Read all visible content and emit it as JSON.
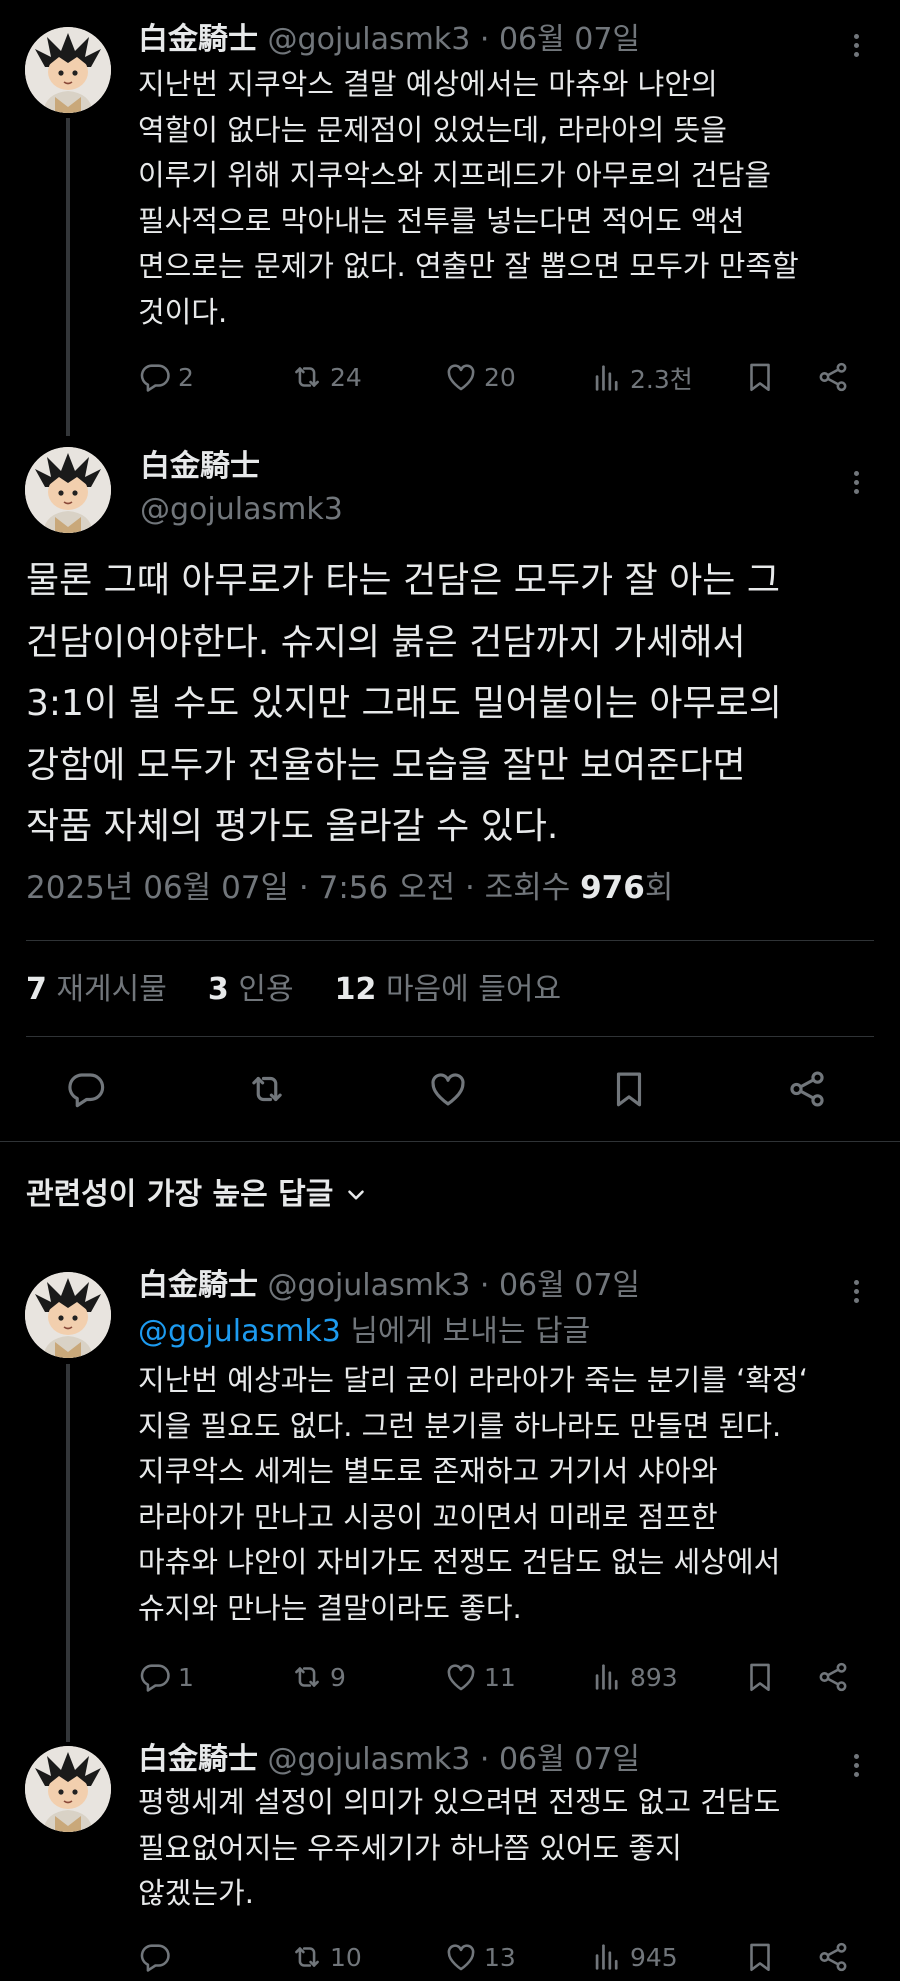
{
  "posts": [
    {
      "name": "白金騎士",
      "handle": "@gojulasmk3",
      "date": "· 06월 07일",
      "text": "지난번 지쿠악스 결말 예상에서는 마츄와 냐안의\n역할이 없다는 문제점이 있었는데, 라라아의 뜻을\n이루기 위해 지쿠악스와 지프레드가 아무로의 건담을\n필사적으로 막아내는 전투를 넣는다면 적어도 액션\n면으로는 문제가 없다. 연출만 잘 뽑으면 모두가 만족할\n것이다.",
      "replies": "2",
      "reposts": "24",
      "likes": "20",
      "views": "2.3천"
    }
  ],
  "main_post": {
    "name": "白金騎士",
    "handle": "@gojulasmk3",
    "text": "물론 그때 아무로가 타는 건담은 모두가 잘 아는 그\n건담이어야한다. 슈지의 붉은 건담까지 가세해서\n3:1이 될 수도 있지만 그래도 밀어붙이는 아무로의\n강함에 모두가 전율하는 모습을 잘만 보여준다면\n작품 자체의 평가도 올라갈 수 있다.",
    "timestamp": "2025년 06월 07일 · 7:56 오전 · 조회수 ",
    "views_count": "976",
    "views_suffix": "회",
    "stats": {
      "reposts_count": "7",
      "reposts_label": "재게시물",
      "quotes_count": "3",
      "quotes_label": "인용",
      "likes_count": "12",
      "likes_label": "마음에 들어요"
    }
  },
  "replies_header": "관련성이 가장 높은 답글",
  "replies": [
    {
      "name": "白金騎士",
      "handle": "@gojulasmk3",
      "date": "· 06월 07일",
      "reply_to_mention": "@gojulasmk3",
      "reply_to_suffix": " 님에게 보내는 답글",
      "text": "지난번 예상과는 달리 굳이 라라아가 죽는 분기를 ‘확정‘\n지을 필요도 없다. 그런 분기를 하나라도 만들면 된다.\n지쿠악스 세계는 별도로 존재하고 거기서 샤아와\n라라아가 만나고 시공이 꼬이면서 미래로 점프한\n마츄와 냐안이 자비가도 전쟁도 건담도 없는 세상에서\n슈지와 만나는 결말이라도 좋다.",
      "replies": "1",
      "reposts": "9",
      "likes": "11",
      "views": "893"
    },
    {
      "name": "白金騎士",
      "handle": "@gojulasmk3",
      "date": "· 06월 07일",
      "text": "평행세계 설정이 의미가 있으려면 전쟁도 없고 건담도\n필요없어지는 우주세기가 하나쯤 있어도 좋지\n않겠는가.",
      "replies": "",
      "reposts": "10",
      "likes": "13",
      "views": "945"
    }
  ],
  "icons": {
    "reply": "reply-icon",
    "repost": "repost-icon",
    "like": "heart-icon",
    "views": "views-icon",
    "bookmark": "bookmark-icon",
    "share": "share-icon",
    "more": "more-icon",
    "chevron": "chevron-down-icon"
  },
  "colors": {
    "background": "#000000",
    "text": "#e7e9ea",
    "muted": "#71767b",
    "link": "#1d9bf0"
  }
}
